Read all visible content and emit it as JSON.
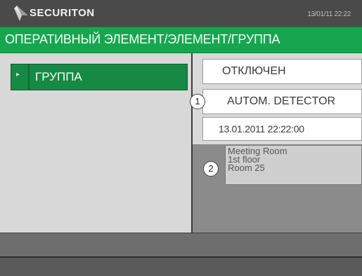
{
  "header": {
    "brand": "SECURITON",
    "datetime": "13/01/11 22:22",
    "logo_icon": "securiton-logo-icon"
  },
  "title_bar": {
    "title": "ОПЕРАТИВНЫЙ ЭЛЕМЕНТ/ЭЛЕМЕНТ/ГРУППА"
  },
  "left_panel": {
    "selected_item": {
      "label": "ГРУППА",
      "icon": "bullet-icon"
    }
  },
  "detail": {
    "status": "ОТКЛЮЧЕН",
    "element_type": "AUTOM. DETECTOR",
    "timestamp": "13.01.2011 22:22:00",
    "location_lines": [
      "Meeting Room",
      "1st floor",
      "Room 25"
    ]
  },
  "callouts": [
    "1",
    "2"
  ],
  "colors": {
    "header_bg": "#4a4a4a",
    "title_green": "#17a650",
    "selected_green": "#168a45",
    "field_white": "#ffffff",
    "right_panel_gray": "#8b8b8b"
  }
}
